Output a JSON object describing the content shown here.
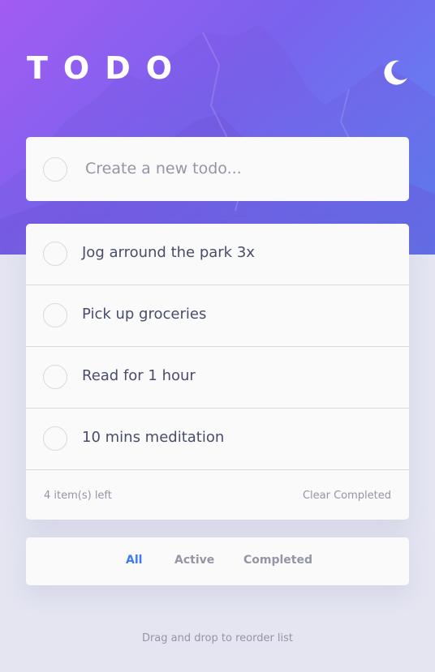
{
  "header": {
    "title": "TODO",
    "theme_icon": "moon-icon"
  },
  "create": {
    "placeholder": "Create a new todo...",
    "value": ""
  },
  "todos": [
    {
      "text": "Jog arround the park 3x",
      "completed": false
    },
    {
      "text": "Pick up groceries",
      "completed": false
    },
    {
      "text": "Read for 1 hour",
      "completed": false
    },
    {
      "text": "10 mins meditation",
      "completed": false
    }
  ],
  "footer": {
    "items_left": "4 item(s) left",
    "clear_label": "Clear Completed"
  },
  "filters": {
    "all": "All",
    "active": "Active",
    "completed": "Completed",
    "selected": "All"
  },
  "hint": "Drag and drop to reorder list",
  "colors": {
    "accent": "#3a7bfd",
    "gradient_start": "#a25cf2",
    "gradient_end": "#5b8bf2",
    "background": "#e4e5f1",
    "card": "#fafafa",
    "text": "#494c6b",
    "muted": "#9495a5"
  }
}
